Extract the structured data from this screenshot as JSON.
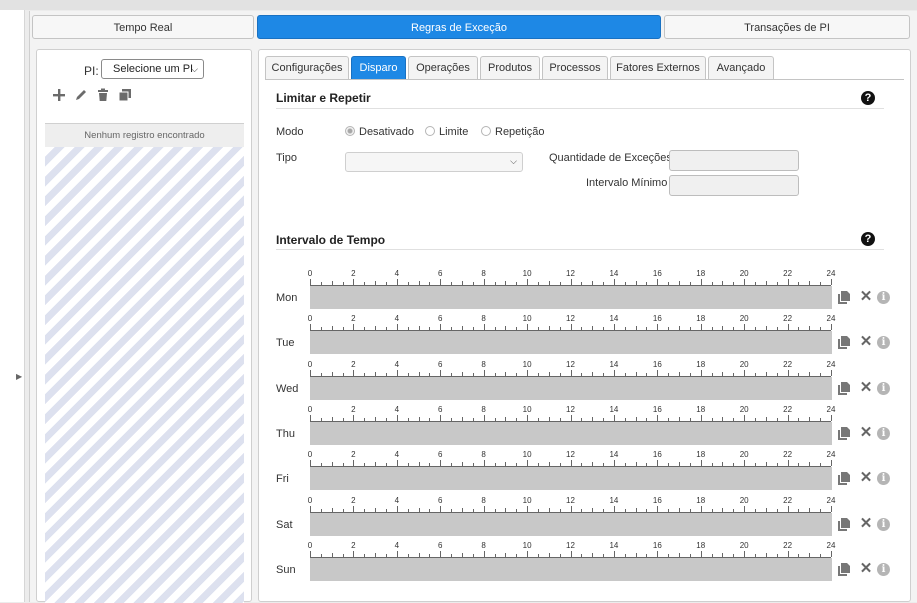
{
  "main_tabs": [
    {
      "label": "Tempo Real",
      "active": false
    },
    {
      "label": "Regras de Exceção",
      "active": true
    },
    {
      "label": "Transações de PI",
      "active": false
    }
  ],
  "left_panel": {
    "pi_label": "PI:",
    "pi_select": "Selecione um PI",
    "toolbar_icons": [
      "plus-icon",
      "pencil-icon",
      "trash-icon",
      "copy-icon"
    ],
    "empty_message": "Nenhum registro encontrado"
  },
  "sub_tabs": [
    {
      "label": "Configurações",
      "active": false
    },
    {
      "label": "Disparo",
      "active": true
    },
    {
      "label": "Operações",
      "active": false
    },
    {
      "label": "Produtos",
      "active": false
    },
    {
      "label": "Processos",
      "active": false
    },
    {
      "label": "Fatores Externos",
      "active": false
    },
    {
      "label": "Avançado",
      "active": false
    }
  ],
  "limit_section": {
    "title": "Limitar e Repetir",
    "help": "?",
    "modo_label": "Modo",
    "modo_options": [
      {
        "label": "Desativado",
        "selected": true
      },
      {
        "label": "Limite",
        "selected": false
      },
      {
        "label": "Repetição",
        "selected": false
      }
    ],
    "tipo_label": "Tipo",
    "tipo_value": "",
    "qtd_label": "Quantidade de Exceções",
    "qtd_value": "",
    "intervalo_label": "Intervalo Mínimo",
    "intervalo_value": ""
  },
  "time_section": {
    "title": "Intervalo de Tempo",
    "help": "?",
    "hour_labels": [
      "0",
      "2",
      "4",
      "6",
      "8",
      "10",
      "12",
      "14",
      "16",
      "18",
      "20",
      "22",
      "24"
    ],
    "days": [
      "Mon",
      "Tue",
      "Wed",
      "Thu",
      "Fri",
      "Sat",
      "Sun"
    ],
    "row_icons": [
      "copy-icon",
      "close-icon",
      "info-icon"
    ],
    "x_symbol": "✕",
    "info_symbol": "i"
  },
  "colors": {
    "accent": "#1e88e5",
    "bar": "#c8c8c8",
    "stripe": "#dde1ef"
  }
}
